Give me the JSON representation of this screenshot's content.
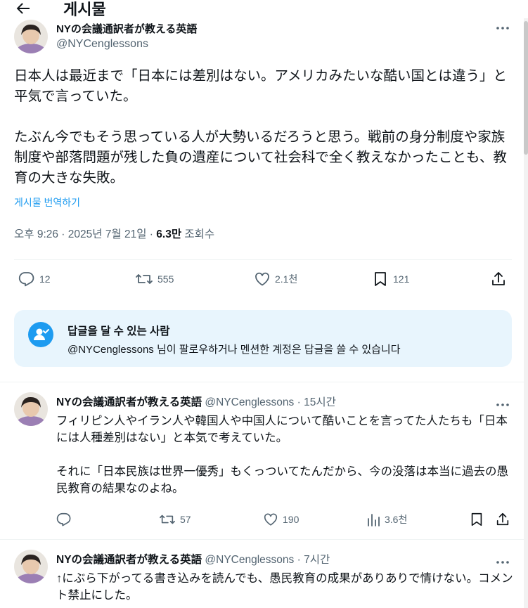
{
  "header": {
    "title": "게시물",
    "back_icon": "arrow-left-icon"
  },
  "main_post": {
    "author_name": "NYの会議通訳者が教える英語",
    "handle": "@NYCenglessons",
    "text": "日本人は最近まで「日本には差別はない。アメリカみたいな酷い国とは違う」と平気で言っていた。\n\nたぶん今でもそう思っている人が大勢いるだろうと思う。戦前の身分制度や家族制度や部落問題が残した負の遺産について社会科で全く教えなかったことも、教育の大きな失敗。",
    "translate_label": "게시물 번역하기",
    "time": "오후 9:26 · 2025년 7월 21일 · ",
    "views_count": "6.3만",
    "views_label": " 조회수",
    "actions": {
      "replies": "12",
      "reposts": "555",
      "likes": "2.1천",
      "bookmarks": "121"
    }
  },
  "reply_restriction": {
    "title": "답글을 달 수 있는 사람",
    "description": "@NYCenglessons 님이 팔로우하거나 멘션한 계정은 답글을 쓸 수 있습니다"
  },
  "replies": [
    {
      "author_name": "NYの会議通訳者が教える英語",
      "handle": "@NYCenglessons",
      "time": "15시간",
      "text": "フィリピン人やイラン人や韓国人や中国人について酷いことを言ってた人たちも「日本には人種差別はない」と本気で考えていた。\n\nそれに「日本民族は世界一優秀」もくっついてたんだから、今の没落は本当に過去の愚民教育の結果なのよね。",
      "actions": {
        "reposts": "57",
        "likes": "190",
        "views": "3.6천"
      }
    },
    {
      "author_name": "NYの会議通訳者が教える英語",
      "handle": "@NYCenglessons",
      "time": "7시간",
      "text": "↑にぶら下がってる書き込みを読んでも、愚民教育の成果がありありで情けない。コメント禁止にした。"
    }
  ],
  "colors": {
    "accent": "#1d9bf0",
    "secondary_text": "#536471",
    "restriction_bg": "#e8f5fd"
  }
}
